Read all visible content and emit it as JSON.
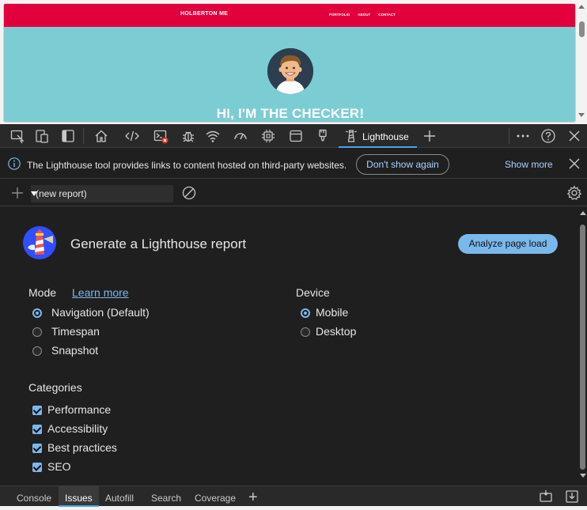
{
  "page": {
    "site_title": "HOLBERTON ME",
    "nav_links": [
      "PORTFOLIO",
      "ABOUT",
      "CONTACT"
    ],
    "hero_text": "HI, I'M THE CHECKER!"
  },
  "toolbar": {
    "active_tab": "Lighthouse"
  },
  "info_bar": {
    "message": "The Lighthouse tool provides links to content hosted on third-party websites.",
    "dont_show": "Don't show again",
    "show_more": "Show more"
  },
  "report_bar": {
    "selected": "(new report)"
  },
  "lighthouse": {
    "title": "Generate a Lighthouse report",
    "analyze_button": "Analyze page load",
    "mode_label": "Mode",
    "learn_more": "Learn more",
    "modes": [
      {
        "label": "Navigation (Default)",
        "selected": true
      },
      {
        "label": "Timespan",
        "selected": false
      },
      {
        "label": "Snapshot",
        "selected": false
      }
    ],
    "device_label": "Device",
    "devices": [
      {
        "label": "Mobile",
        "selected": true
      },
      {
        "label": "Desktop",
        "selected": false
      }
    ],
    "categories_label": "Categories",
    "categories": [
      {
        "label": "Performance",
        "checked": true
      },
      {
        "label": "Accessibility",
        "checked": true
      },
      {
        "label": "Best practices",
        "checked": true
      },
      {
        "label": "SEO",
        "checked": true
      }
    ]
  },
  "drawer": {
    "tabs": [
      "Console",
      "Issues",
      "Autofill",
      "Search",
      "Coverage"
    ],
    "active": "Issues"
  },
  "colors": {
    "nav_red": "#e1003c",
    "page_teal": "#7ccdd3",
    "accent_blue": "#7ab8ec"
  }
}
